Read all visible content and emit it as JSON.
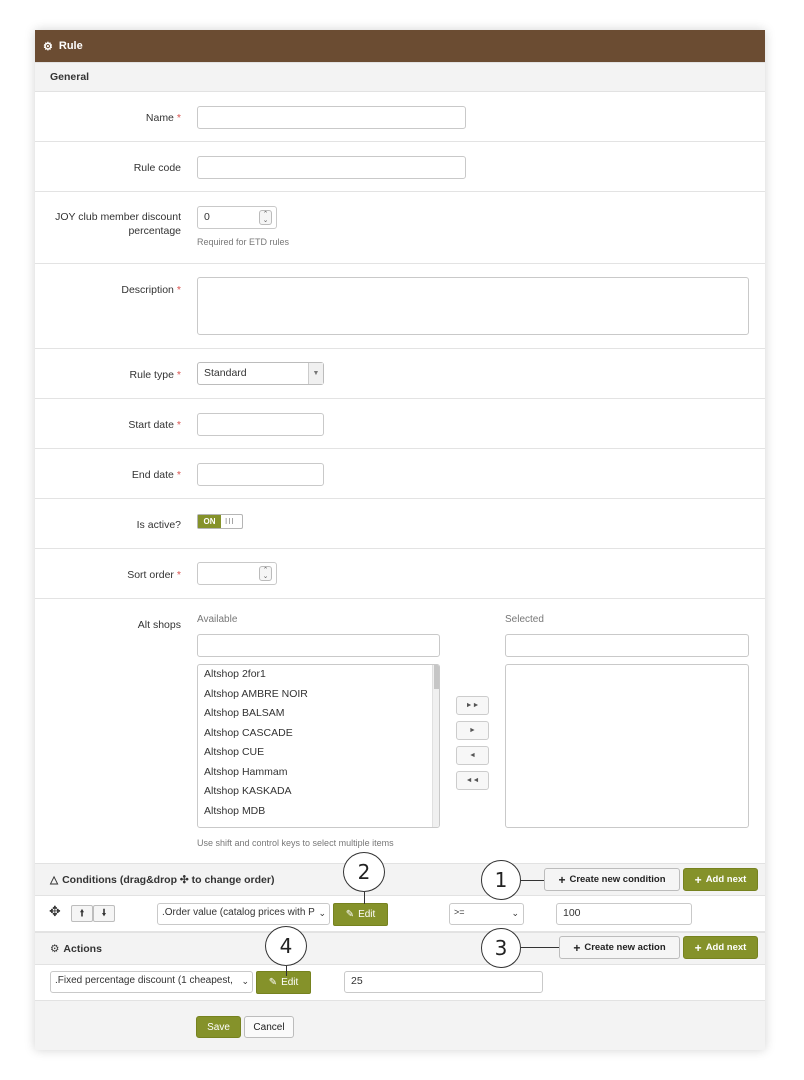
{
  "title": "Rule",
  "general": {
    "heading": "General",
    "name_label": "Name",
    "rule_code_label": "Rule code",
    "discount_label_line1": "JOY club member discount",
    "discount_label_line2": "percentage",
    "discount_value": "0",
    "discount_help": "Required for ETD rules",
    "description_label": "Description",
    "rule_type_label": "Rule type",
    "rule_type_value": "Standard",
    "start_date_label": "Start date",
    "end_date_label": "End date",
    "is_active_label": "Is active?",
    "is_active_value": "ON",
    "sort_order_label": "Sort order",
    "alt_shops_label": "Alt shops",
    "available_label": "Available",
    "selected_label": "Selected",
    "available_items": [
      "Altshop 2for1",
      "Altshop AMBRE NOIR",
      "Altshop BALSAM",
      "Altshop CASCADE",
      "Altshop CUE",
      "Altshop Hammam",
      "Altshop KASKADA",
      "Altshop MDB"
    ],
    "multi_select_help": "Use shift and control keys to select multiple items",
    "required_mark": "*"
  },
  "conditions": {
    "heading": "Conditions (drag&drop ✣ to change order)",
    "create_label": "Create new condition",
    "add_next_label": "Add next",
    "row": {
      "type_value": ".Order value (catalog prices with P",
      "edit_label": "Edit",
      "operator_value": ">=",
      "amount_value": "100"
    }
  },
  "actions": {
    "heading": "Actions",
    "create_label": "Create new action",
    "add_next_label": "Add next",
    "row": {
      "type_value": ".Fixed percentage discount (1 cheapest,",
      "edit_label": "Edit",
      "amount_value": "25"
    }
  },
  "footer": {
    "save_label": "Save",
    "cancel_label": "Cancel"
  },
  "callouts": {
    "c1": "1",
    "c2": "2",
    "c3": "3",
    "c4": "4"
  },
  "colors": {
    "titlebar": "#6b4c32",
    "accent_green": "#85922a",
    "required": "#d9534f"
  }
}
